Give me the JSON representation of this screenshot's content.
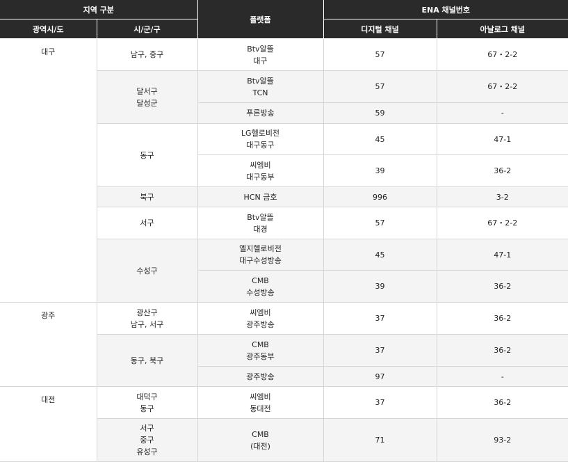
{
  "header": {
    "region": "지역 구분",
    "platform": "플랫폼",
    "ena": "ENA 채널번호",
    "province": "광역시/도",
    "city": "시/군/구",
    "digital": "디지털 채널",
    "analog": "아날로그 채널"
  },
  "rows": [
    {
      "province": "대구",
      "city": [
        "남구, 중구"
      ],
      "platform": [
        "Btv알뜰",
        "대구"
      ],
      "digital": "57",
      "analog": "67・2-2"
    },
    {
      "city": [
        "달서구",
        "달성군"
      ],
      "platform": [
        "Btv알뜰",
        "TCN"
      ],
      "digital": "57",
      "analog": "67・2-2"
    },
    {
      "platform": [
        "푸른방송"
      ],
      "digital": "59",
      "analog": "-"
    },
    {
      "city": [
        "동구"
      ],
      "platform": [
        "LG헬로비전",
        "대구동구"
      ],
      "digital": "45",
      "analog": "47-1"
    },
    {
      "platform": [
        "씨엠비",
        "대구동부"
      ],
      "digital": "39",
      "analog": "36-2"
    },
    {
      "city": [
        "북구"
      ],
      "platform": [
        "HCN 금호"
      ],
      "digital": "996",
      "analog": "3-2"
    },
    {
      "city": [
        "서구"
      ],
      "platform": [
        "Btv알뜰",
        "대경"
      ],
      "digital": "57",
      "analog": "67・2-2"
    },
    {
      "city": [
        "수성구"
      ],
      "platform": [
        "엘지헬로비전",
        "대구수성방송"
      ],
      "digital": "45",
      "analog": "47-1"
    },
    {
      "platform": [
        "CMB",
        "수성방송"
      ],
      "digital": "39",
      "analog": "36-2"
    },
    {
      "province": "광주",
      "city": [
        "광산구",
        "남구, 서구"
      ],
      "platform": [
        "씨엠비",
        "광주방송"
      ],
      "digital": "37",
      "analog": "36-2"
    },
    {
      "city": [
        "동구, 북구"
      ],
      "platform": [
        "CMB",
        "광주동부"
      ],
      "digital": "37",
      "analog": "36-2"
    },
    {
      "platform": [
        "광주방송"
      ],
      "digital": "97",
      "analog": "-"
    },
    {
      "province": "대전",
      "city": [
        "대덕구",
        "동구"
      ],
      "platform": [
        "씨엠비",
        "동대전"
      ],
      "digital": "37",
      "analog": "36-2"
    },
    {
      "city": [
        "서구",
        "중구",
        "유성구"
      ],
      "platform": [
        "CMB",
        "(대전)"
      ],
      "digital": "71",
      "analog": "93-2"
    }
  ]
}
